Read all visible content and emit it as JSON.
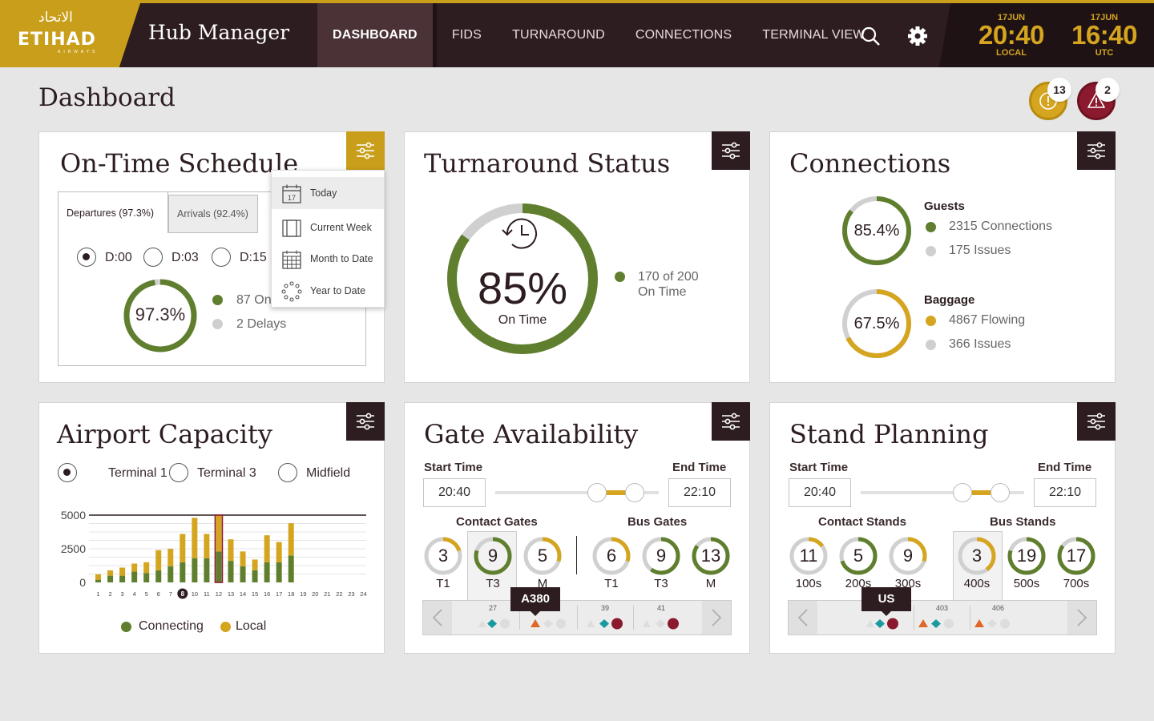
{
  "colors": {
    "gold": "#c89e1a",
    "green": "#5f7f2e",
    "maroon": "#8b1a2e",
    "dark": "#2d1d20",
    "grey": "#cfcfcf",
    "teal": "#1a9aa0",
    "orange": "#e0672a"
  },
  "header": {
    "logo_arabic": "الاتحاد",
    "logo_text": "ETIHAD",
    "logo_sub": "AIRWAYS",
    "app_title": "Hub Manager",
    "nav": [
      "DASHBOARD",
      "FIDS",
      "TURNAROUND",
      "CONNECTIONS",
      "TERMINAL VIEW"
    ],
    "active_nav": "DASHBOARD",
    "icons": [
      "search-icon",
      "gear-icon"
    ],
    "clocks": [
      {
        "date": "17JUN",
        "time": "20:40",
        "zone": "LOCAL"
      },
      {
        "date": "17JUN",
        "time": "16:40",
        "zone": "UTC"
      }
    ]
  },
  "page": {
    "title": "Dashboard",
    "alerts": [
      {
        "icon": "info-icon",
        "count": "13",
        "color": "#d5a520"
      },
      {
        "icon": "warning-icon",
        "count": "2",
        "color": "#8b1a2e"
      }
    ]
  },
  "on_time": {
    "title": "On-Time Schedule",
    "tabs": [
      "Departures (97.3%)",
      "Arrivals (92.4%)"
    ],
    "radios": [
      "D:00",
      "D:03",
      "D:15"
    ],
    "ring_value": 0.973,
    "ring_label": "97.3%",
    "legend": [
      "87 On",
      "2 Delays"
    ],
    "dropdown": [
      "Today",
      "Current Week",
      "Month to Date",
      "Year to Date"
    ],
    "dropdown_icon_day": "17"
  },
  "turnaround": {
    "title": "Turnaround Status",
    "ring_value": 0.85,
    "percent": "85%",
    "caption": "On Time",
    "legend": [
      "170 of 200",
      "On Time"
    ]
  },
  "connections": {
    "title": "Connections",
    "guests": {
      "title": "Guests",
      "ring_label": "85.4%",
      "ring_value": 0.854,
      "items": [
        "2315 Connections",
        "175 Issues"
      ]
    },
    "baggage": {
      "title": "Baggage",
      "ring_label": "67.5%",
      "ring_value": 0.675,
      "items": [
        "4867 Flowing",
        "366 Issues"
      ]
    }
  },
  "capacity": {
    "title": "Airport Capacity",
    "radios": [
      "Terminal 1",
      "Terminal 3",
      "Midfield"
    ],
    "legend": [
      "Connecting",
      "Local"
    ],
    "chart_data": {
      "type": "bar",
      "categories": [
        "1",
        "2",
        "3",
        "4",
        "5",
        "6",
        "7",
        "8",
        "10",
        "11",
        "12",
        "13",
        "14",
        "15",
        "16",
        "17",
        "18",
        "19",
        "20",
        "21",
        "22",
        "23",
        "24"
      ],
      "series": [
        {
          "name": "Connecting",
          "values": [
            200,
            500,
            500,
            800,
            700,
            900,
            1200,
            1500,
            1800,
            1800,
            2300,
            1600,
            1200,
            900,
            1500,
            1500,
            2000,
            0,
            0,
            0,
            0,
            0,
            0
          ]
        },
        {
          "name": "Local",
          "values": [
            400,
            400,
            600,
            600,
            800,
            1500,
            1300,
            2100,
            3000,
            1800,
            2700,
            1600,
            1100,
            800,
            2000,
            1500,
            2400,
            0,
            0,
            0,
            0,
            0,
            0
          ]
        }
      ],
      "yticks": [
        "5000",
        "2500",
        "0"
      ],
      "ylim": [
        0,
        5000
      ],
      "highlight": "8",
      "selected": "12"
    }
  },
  "gates": {
    "title": "Gate Availability",
    "start_label": "Start Time",
    "end_label": "End Time",
    "start": "20:40",
    "end": "22:10",
    "group1": "Contact Gates",
    "group2": "Bus Gates",
    "items": [
      {
        "value": "3",
        "label": "T1",
        "frac": 0.2,
        "color": "#d5a520"
      },
      {
        "value": "9",
        "label": "T3",
        "frac": 0.8,
        "color": "#5f7f2e"
      },
      {
        "value": "5",
        "label": "M",
        "frac": 0.3,
        "color": "#d5a520"
      },
      {
        "value": "6",
        "label": "T1",
        "frac": 0.3,
        "color": "#d5a520"
      },
      {
        "value": "9",
        "label": "T3",
        "frac": 0.6,
        "color": "#5f7f2e"
      },
      {
        "value": "13",
        "label": "M",
        "frac": 0.85,
        "color": "#5f7f2e"
      }
    ],
    "strip_cols": [
      "27",
      "",
      "39",
      "41"
    ],
    "tooltip": "A380"
  },
  "stands": {
    "title": "Stand Planning",
    "start_label": "Start Time",
    "end_label": "End Time",
    "start": "20:40",
    "end": "22:10",
    "group1": "Contact Stands",
    "group2": "Bus Stands",
    "items": [
      {
        "value": "11",
        "label": "100s",
        "frac": 0.15,
        "color": "#d5a520"
      },
      {
        "value": "5",
        "label": "200s",
        "frac": 0.7,
        "color": "#5f7f2e"
      },
      {
        "value": "9",
        "label": "300s",
        "frac": 0.3,
        "color": "#d5a520"
      },
      {
        "value": "3",
        "label": "400s",
        "frac": 0.4,
        "color": "#d5a520"
      },
      {
        "value": "19",
        "label": "500s",
        "frac": 0.8,
        "color": "#5f7f2e"
      },
      {
        "value": "17",
        "label": "700s",
        "frac": 0.85,
        "color": "#5f7f2e"
      }
    ],
    "strip_cols": [
      "",
      "403",
      "406"
    ],
    "tooltip": "US"
  }
}
